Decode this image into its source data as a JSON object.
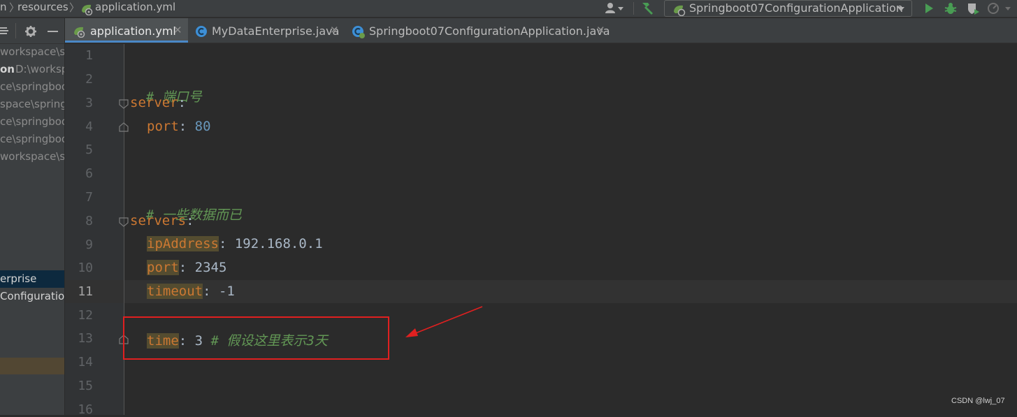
{
  "window": {
    "breadcrumbs": [
      "n",
      "resources",
      "application.yml"
    ]
  },
  "run_config": {
    "name": "Springboot07ConfigurationApplication"
  },
  "project_tree": {
    "rows": [
      "workspace\\s",
      "on",
      "D:\\worksp",
      "ce\\springboo",
      "space\\springl",
      "ce\\springboo",
      "ce\\springboo",
      "workspace\\s",
      "erprise",
      "Configuration"
    ]
  },
  "tabs": [
    {
      "label": "application.yml",
      "icon": "yaml-spring-icon",
      "active": true
    },
    {
      "label": "MyDataEnterprise.java",
      "icon": "java-class-icon",
      "active": false
    },
    {
      "label": "Springboot07ConfigurationApplication.java",
      "icon": "spring-boot-app-icon",
      "active": false
    }
  ],
  "editor": {
    "current_line": 11,
    "line_numbers": [
      "1",
      "2",
      "3",
      "4",
      "5",
      "6",
      "7",
      "8",
      "9",
      "10",
      "11",
      "12",
      "13",
      "14",
      "15",
      "16"
    ],
    "lines": {
      "l2_comment": "# 端口号",
      "l3_key": "server",
      "l3_colon": ":",
      "l4_key": "port",
      "l4_colon": ": ",
      "l4_value": "80",
      "l7_comment": "# 一些数据而已",
      "l8_key": "servers",
      "l8_colon": ":",
      "l9_key": "ipAddress",
      "l9_rest": ": 192.168.0.1",
      "l10_key": "port",
      "l10_rest": ": 2345",
      "l11_key": "timeout",
      "l11_rest": ": -1",
      "l13_key": "time",
      "l13_rest": ": 3 ",
      "l13_comment": "# 假设这里表示3天"
    }
  },
  "watermark": "CSDN @lwj_07",
  "colors": {
    "annotation": "#e02020",
    "keyword": "#cc7832",
    "comment": "#629755",
    "number": "#6897bb"
  }
}
